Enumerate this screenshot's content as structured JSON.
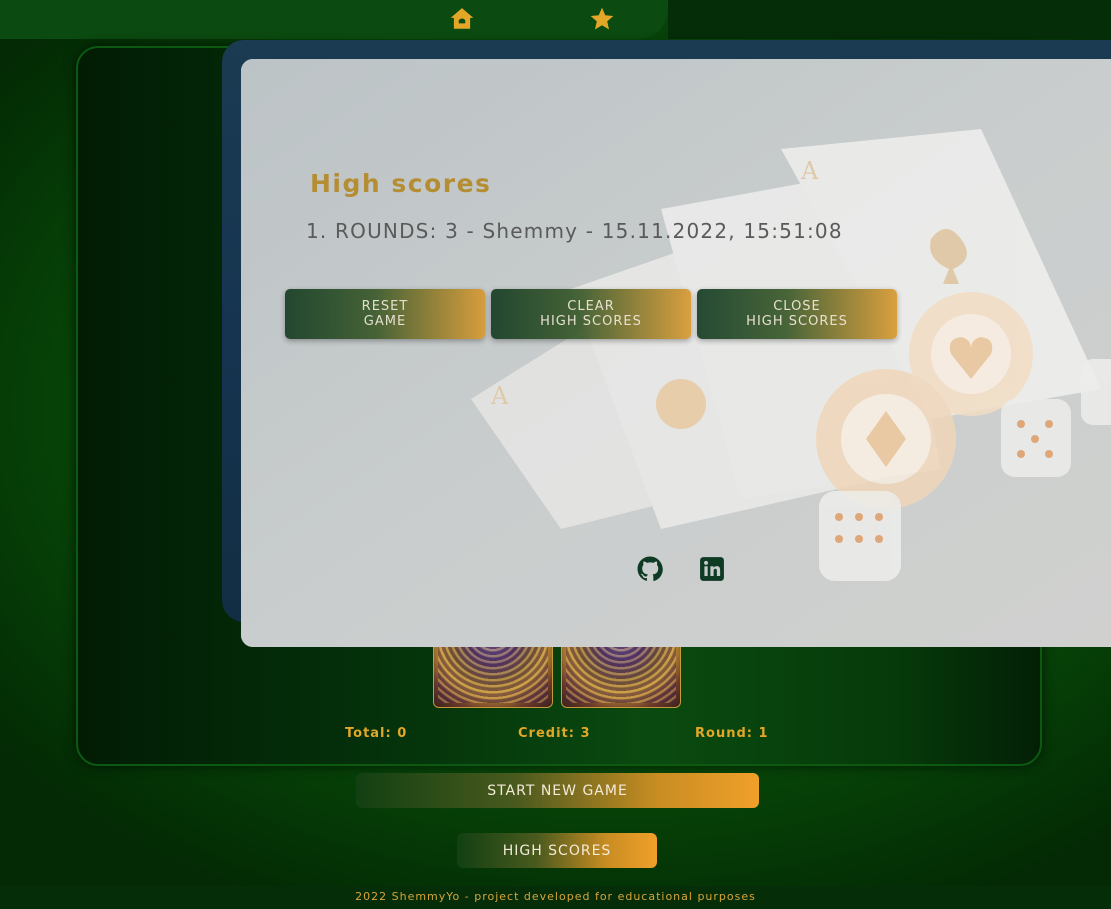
{
  "nav": {
    "home_icon": "house-icon",
    "star_icon": "star-icon"
  },
  "modal": {
    "title": "High scores",
    "scores": [
      "1. ROUNDS: 3 - Shemmy - 15.11.2022, 15:51:08"
    ],
    "buttons": {
      "reset": [
        "RESET",
        "GAME"
      ],
      "clear": [
        "CLEAR",
        "HIGH SCORES"
      ],
      "close": [
        "CLOSE",
        "HIGH SCORES"
      ]
    },
    "social": {
      "github": "github-icon",
      "linkedin": "linkedin-icon"
    }
  },
  "stats": {
    "total": "Total: 0",
    "credit": "Credit: 3",
    "round": "Round: 1"
  },
  "actions": {
    "start": "START NEW GAME",
    "highscores": "HIGH SCORES"
  },
  "footer": {
    "text": "2022 ShemmyYo - project developed for educational purposes"
  },
  "colors": {
    "accent": "#e3a727",
    "title_gold": "#b58e33",
    "felt_green": "#0a5a0c"
  }
}
